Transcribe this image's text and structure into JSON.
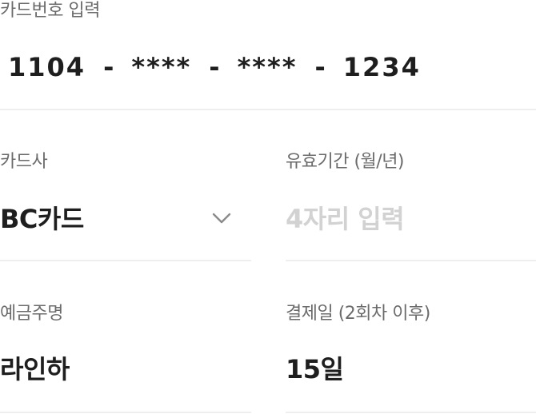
{
  "card_number": {
    "label": "카드번호 입력",
    "segments": [
      "1104",
      "****",
      "****",
      "1234"
    ],
    "separator": "-"
  },
  "card_company": {
    "label": "카드사",
    "selected": "BC카드",
    "icon": "chevron-down-icon"
  },
  "expiry": {
    "label": "유효기간 (월/년)",
    "value": "",
    "placeholder": "4자리 입력"
  },
  "account_holder": {
    "label": "예금주명",
    "value": "라인하"
  },
  "payment_day": {
    "label": "결제일 (2회차 이후)",
    "value": "15일"
  },
  "colors": {
    "label": "#6b6b6b",
    "value": "#1e1e1e",
    "placeholder": "#d2d2d2",
    "divider": "#eeeeee"
  }
}
